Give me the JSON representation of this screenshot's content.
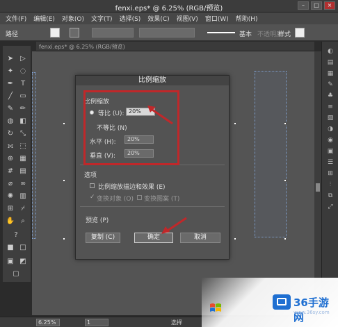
{
  "window": {
    "title": "fenxi.eps* @ 6.25% (RGB/预览)"
  },
  "menubar": {
    "items": [
      "文件(F)",
      "编辑(E)",
      "对象(O)",
      "文字(T)",
      "选择(S)",
      "效果(C)",
      "视图(V)",
      "窗口(W)",
      "帮助(H)"
    ]
  },
  "controlbar": {
    "path_label": "路径",
    "stroke_style_label": "基本",
    "opacity_label": "不透明度",
    "style_label": "样式"
  },
  "doctab": {
    "label": "fenxi.eps* @ 6.25% (RGB/预览)"
  },
  "dialog": {
    "title": "比例缩放",
    "scale_group_label": "比例缩放",
    "uniform_label": "等比 (U):",
    "uniform_value": "20%",
    "nonuniform_label": "不等比 (N)",
    "horizontal_label": "水平 (H):",
    "horizontal_value": "20%",
    "vertical_label": "垂直 (V):",
    "vertical_value": "20%",
    "options_label": "选项",
    "scale_strokes_label": "比例缩放描边和效果 (E)",
    "transform_objects_label": "变换对象 (O)",
    "transform_patterns_label": "变换图案 (T)",
    "preview_label": "预览 (P)",
    "copy_button": "复制 (C)",
    "ok_button": "确定",
    "cancel_button": "取消"
  },
  "statusbar": {
    "zoom": "6.25%",
    "page": "1",
    "status": "选择"
  },
  "watermark": {
    "brand": "36手游网",
    "sub": "www.36sy.com"
  },
  "colors": {
    "annotation": "#c0282a",
    "brand": "#1f6fd1"
  }
}
